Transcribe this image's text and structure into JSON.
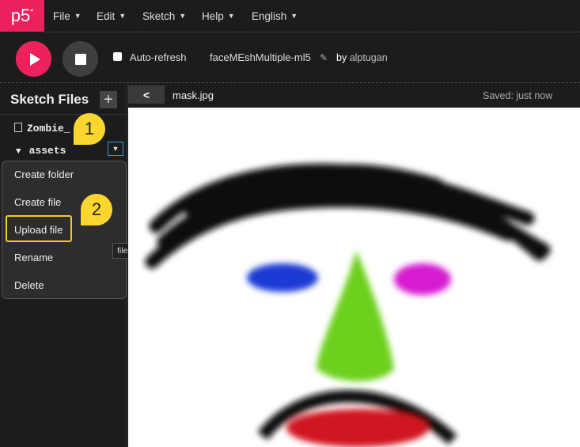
{
  "app": {
    "logo": "p5",
    "logo_mark": "*"
  },
  "menu": [
    {
      "label": "File"
    },
    {
      "label": "Edit"
    },
    {
      "label": "Sketch"
    },
    {
      "label": "Help"
    },
    {
      "label": "English"
    }
  ],
  "toolbar": {
    "autorefresh_label": "Auto-refresh",
    "autorefresh_checked": false,
    "sketch_name": "faceMEshMultiple-ml5",
    "by_label": "by",
    "author": "alptugan"
  },
  "sidebar": {
    "title": "Sketch Files",
    "add_label": "+",
    "files": [
      {
        "name": "Zombie_"
      }
    ],
    "folder": {
      "name": "assets",
      "expanded": true
    }
  },
  "dropdown": {
    "items": [
      {
        "label": "Create folder"
      },
      {
        "label": "Create file"
      },
      {
        "label": "Upload file"
      },
      {
        "label": "Rename"
      },
      {
        "label": "Delete"
      }
    ],
    "highlighted": "Upload file"
  },
  "callouts": [
    "1",
    "2"
  ],
  "tooltip": "file options",
  "editor": {
    "back_label": "<",
    "filename": "mask.jpg",
    "status": "Saved: just now"
  },
  "colors": {
    "accent": "#ed225d",
    "callout": "#fad62f",
    "focus": "#2f9bd8"
  }
}
